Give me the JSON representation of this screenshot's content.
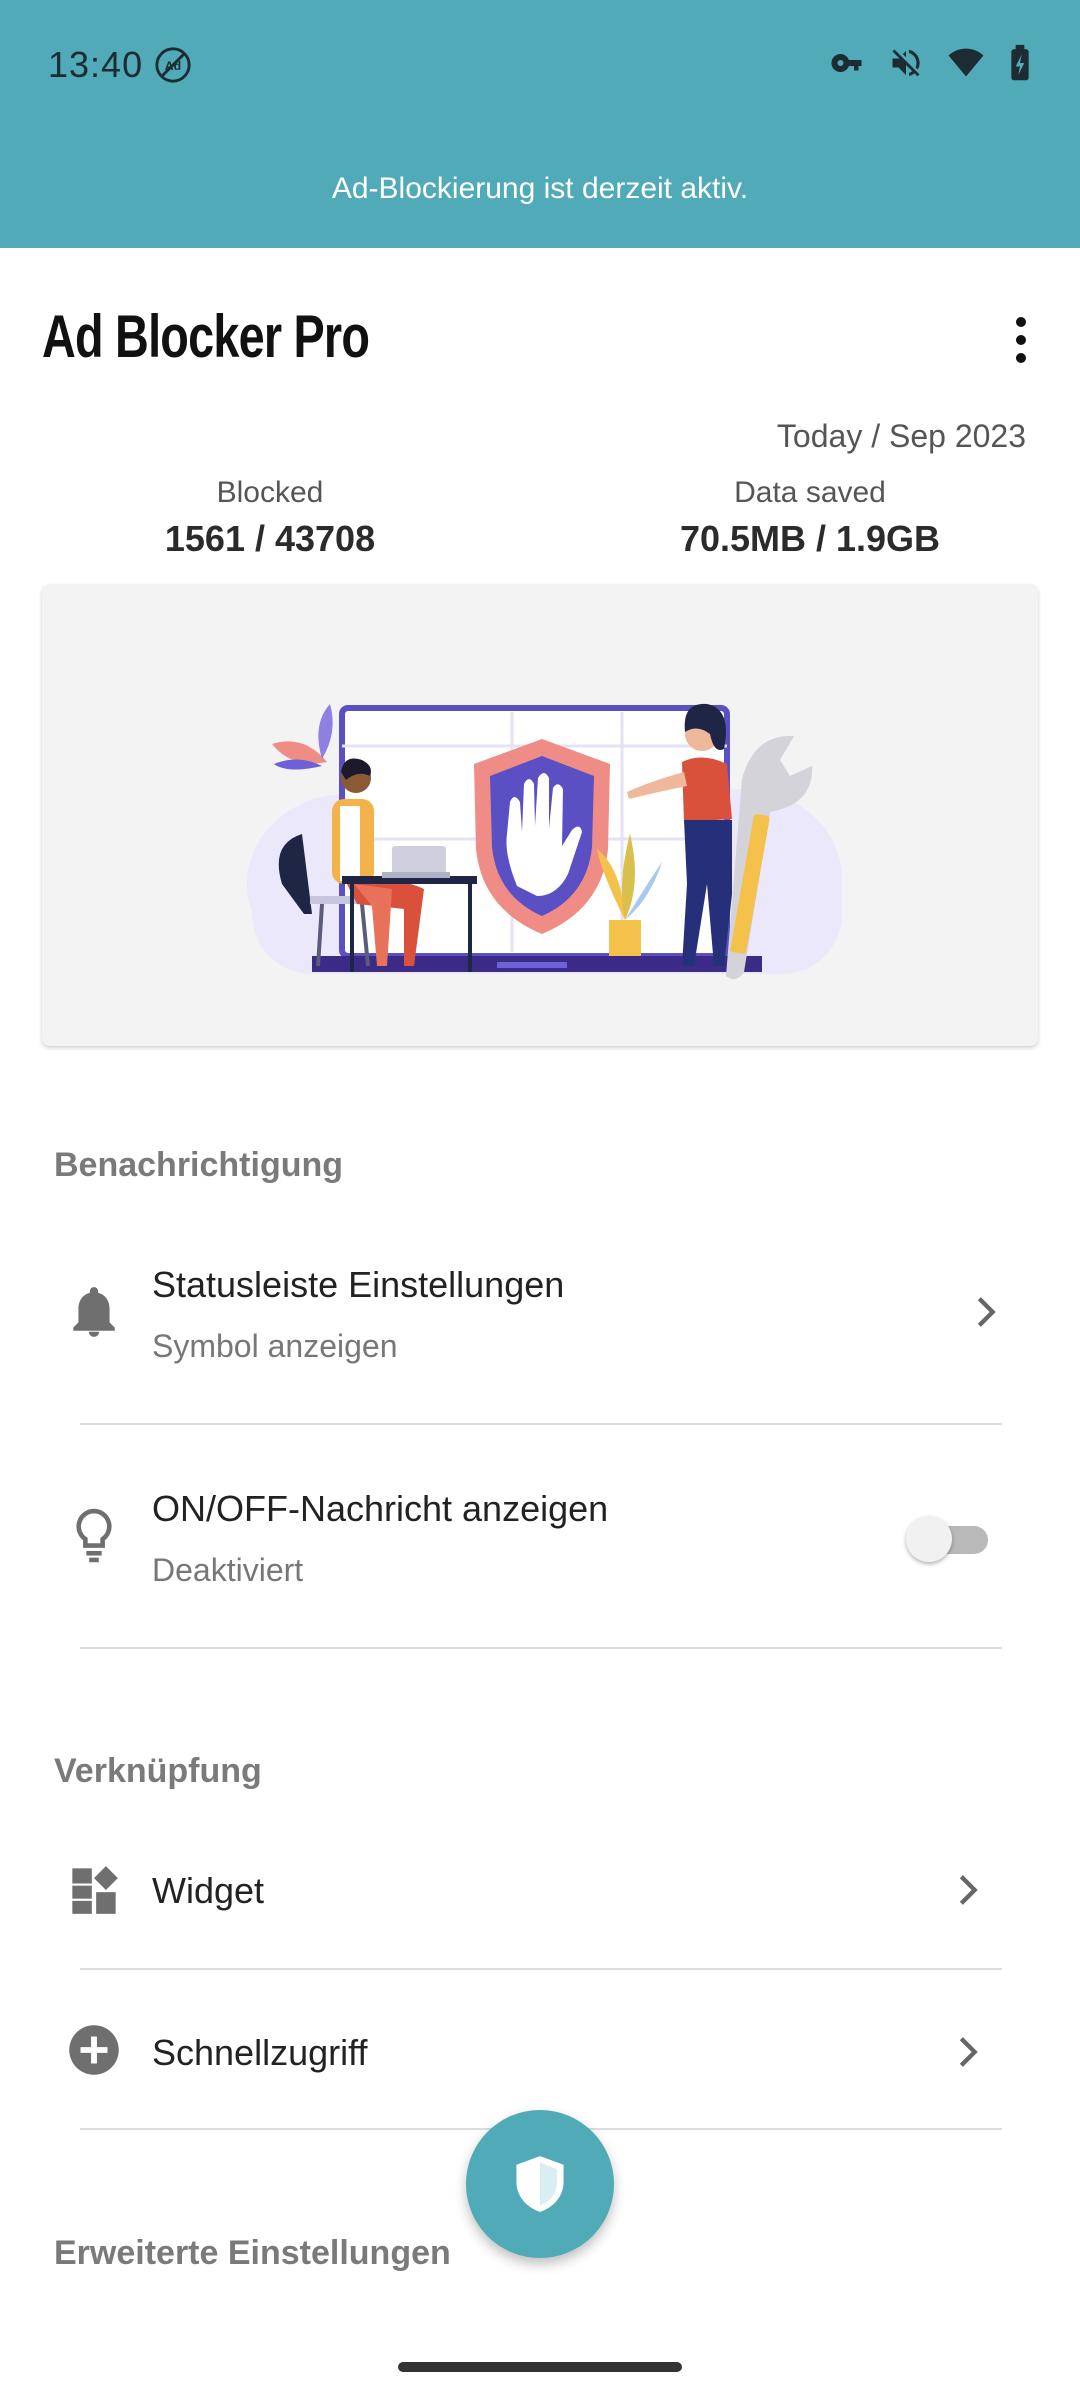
{
  "status_bar": {
    "time": "13:40"
  },
  "banner": {
    "text": "Ad-Blockierung ist derzeit aktiv."
  },
  "app": {
    "title": "Ad Blocker Pro"
  },
  "stats": {
    "period": "Today / Sep 2023",
    "blocked_label": "Blocked",
    "blocked_value": "1561 / 43708",
    "data_label": "Data saved",
    "data_value": "70.5MB / 1.9GB"
  },
  "sections": {
    "notification": {
      "title": "Benachrichtigung",
      "items": [
        {
          "title": "Statusleiste Einstellungen",
          "subtitle": "Symbol anzeigen",
          "icon": "bell-icon"
        },
        {
          "title": "ON/OFF-Nachricht anzeigen",
          "subtitle": "Deaktiviert",
          "icon": "lightbulb-icon",
          "toggle_on": false
        }
      ]
    },
    "shortcut": {
      "title": "Verknüpfung",
      "items": [
        {
          "title": "Widget",
          "icon": "widget-icon"
        },
        {
          "title": "Schnellzugriff",
          "icon": "add-circle-icon"
        }
      ]
    },
    "advanced": {
      "title": "Erweiterte Einstellungen"
    }
  },
  "fab": {
    "icon": "shield-icon"
  },
  "colors": {
    "accent": "#51aab8",
    "shield": "#5b4fc4",
    "shield_border": "#ef8c86"
  }
}
